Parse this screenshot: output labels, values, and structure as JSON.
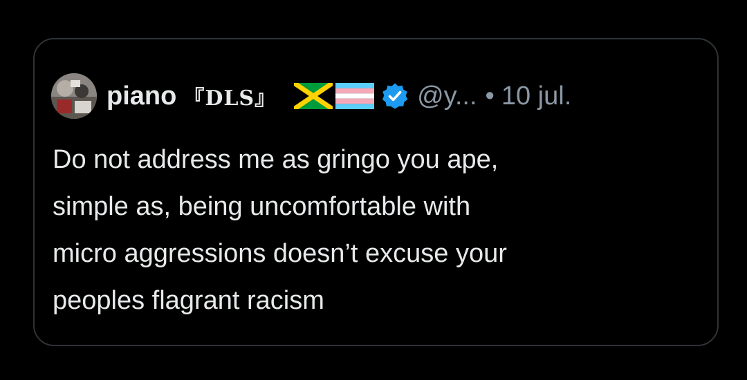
{
  "tweet": {
    "display_name": "piano",
    "name_tag": "『DLS』",
    "flags": [
      "jamaica-flag-icon",
      "transgender-flag-icon"
    ],
    "verified": true,
    "handle": "@y...",
    "separator": "•",
    "date": "10 jul.",
    "text_lines": [
      "Do not address me as gringo you ape,",
      "simple as, being uncomfortable with",
      "micro aggressions doesn’t excuse your",
      "peoples flagrant racism"
    ]
  },
  "colors": {
    "background": "#000000",
    "border": "#2f3336",
    "primary_text": "#e7e9ea",
    "secondary_text": "#8b98a5",
    "verified_blue": "#1d9bf0"
  }
}
